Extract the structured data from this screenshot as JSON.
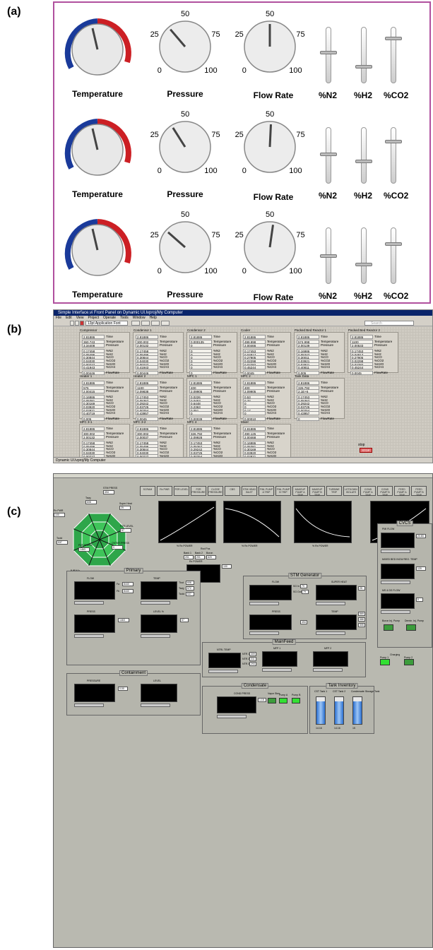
{
  "labels": {
    "a": "(a)",
    "b": "(b)",
    "c": "(c)"
  },
  "panel_a": {
    "rows": [
      {
        "temp_label": "Temperature",
        "pressure_label": "Pressure",
        "flow_label": "Flow Rate",
        "pressure_value": 35,
        "flow_value": 50,
        "n2": 0.58,
        "h2": 0.32,
        "co2": 0.82
      },
      {
        "temp_label": "Temperature",
        "pressure_label": "Pressure",
        "flow_label": "Flow Rate",
        "pressure_value": 38,
        "flow_value": 51,
        "n2": 0.55,
        "h2": 0.42,
        "co2": 0.78
      },
      {
        "temp_label": "Temperature",
        "pressure_label": "Pressure",
        "flow_label": "Flow Rate",
        "pressure_value": 32,
        "flow_value": 53,
        "n2": 0.52,
        "h2": 0.38,
        "co2": 0.74
      }
    ],
    "scale": {
      "s0": "0",
      "s25": "25",
      "s50": "50",
      "s75": "75",
      "s100": "100"
    },
    "slider_labels": {
      "n2": "%N2",
      "h2": "%H2",
      "co2": "%CO2"
    }
  },
  "panel_b": {
    "title": "Simple Interface.vi Front Panel on Dynamic UI.lvproj/My Computer",
    "menu": [
      "File",
      "Edit",
      "View",
      "Project",
      "Operate",
      "Tools",
      "Window",
      "Help"
    ],
    "font_select": "13pt Application Font",
    "search_placeholder": "Search",
    "row_names": {
      "time": "Time",
      "temp": "Temperature",
      "pres": "Pressure",
      "n2": "%N2",
      "h2": "%H2",
      "co": "%CO",
      "co2": "%CO2",
      "h2o": "%H2O",
      "ch4": "%CH4",
      "flow": "FlowRate"
    },
    "clusters": [
      {
        "name": "Compressor",
        "v": [
          "2.81886",
          "360.743",
          "3.34408",
          "0.17458",
          "0.05496",
          "0.30844",
          "0.04030",
          "0.00227",
          "0.41943",
          "0.00446"
        ]
      },
      {
        "name": "Condensor 1",
        "v": [
          "2.81886",
          "300.002",
          "2.00132",
          "0.17458",
          "0.05496",
          "0.30844",
          "0.04030",
          "0.00227",
          "0.41943",
          "0.00446"
        ]
      },
      {
        "name": "Condensor 2",
        "v": [
          "2.81886",
          "0.000135",
          "0",
          "0",
          "0",
          "0",
          "0",
          "0",
          "0",
          "0"
        ]
      },
      {
        "name": "Cooler",
        "v": [
          "2.81886",
          "499.998",
          "2.00466",
          "0.17453",
          "0.04817",
          "0.27905",
          "0.02298",
          "0.02282",
          "0.45244",
          "0.0045"
        ]
      },
      {
        "name": "Packed Bed Reactor 1",
        "v": [
          "2.81886",
          "574.998",
          "2.00139",
          "0.16986",
          "0.05347",
          "0.30011",
          "0.03921",
          "0.02921",
          "0.40811",
          "0.005"
        ]
      },
      {
        "name": "Packed Bed Reactor 2",
        "v": [
          "2.81886",
          "1100",
          "2.00533",
          "0.17453",
          "0.04817",
          "0.27905",
          "0.02298",
          "0.02282",
          "0.45244",
          "0.0045"
        ]
      },
      {
        "name": "Heater 1",
        "v": [
          "2.81886",
          "575",
          "2.00415",
          "0.16986",
          "0.05381",
          "0.30169",
          "0.03920",
          "0.02821",
          "0.40719",
          "0.005"
        ]
      },
      {
        "name": "Heater 2",
        "v": [
          "2.81886",
          "1100",
          "2.09838",
          "0.17453",
          "0.05367",
          "0.29242",
          "0.03725",
          "0.00254",
          "0.43957",
          "0.0045"
        ]
      },
      {
        "name": "MPC 1",
        "v": [
          "2.81886",
          "400",
          "2.09905",
          "0.0226",
          "0.0453",
          "0.6448",
          "0.2363",
          "0.051",
          "0",
          "0.00039"
        ]
      },
      {
        "name": "MPC 2",
        "v": [
          "2.81886",
          "400",
          "2.09905",
          "0.53",
          "0.32",
          "0",
          "0",
          "0.17",
          "0",
          "0.00010"
        ]
      },
      {
        "name": "Tank Data",
        "v": [
          "2.81886",
          "326.792",
          "2.1E+6",
          "0.17453",
          "0.05367",
          "0.29242",
          "0.03725",
          "0.00254",
          "0.43957",
          "0"
        ]
      },
      {
        "name": "MFC 3-1",
        "v": [
          "2.81886",
          "300.002",
          "2.00132",
          "0.17458",
          "0.05496",
          "0.30844",
          "0.04030",
          "0.00227",
          "0.41943",
          "0.00446"
        ]
      },
      {
        "name": "MFC 3-2",
        "v": [
          "2.81886",
          "300.002",
          "2.00037",
          "0.17458",
          "0.05496",
          "0.30844",
          "0.04030",
          "0.00227",
          "0.41943",
          "0.0004"
        ]
      },
      {
        "name": "MFC 4",
        "v": [
          "2.81886",
          "326.792",
          "2.09928",
          "0.17453",
          "0.05367",
          "0.29242",
          "0.03725",
          "0.00254",
          "0.43957",
          "0.0045"
        ]
      },
      {
        "name": "Mixer",
        "v": [
          "2.81886",
          "490.125",
          "2.00468",
          "0.16986",
          "0.05381",
          "0.30169",
          "0.03920",
          "0.02821",
          "0.40719",
          "0.005"
        ]
      }
    ],
    "stop_label": "stop",
    "stop_button": "STOP",
    "status": "Dynamic UI.lvproj/My Computer"
  },
  "panel_c": {
    "buttons": [
      "SCRAM",
      "Rx PWR",
      "PZR LEVEL",
      "PZR PRESSURE",
      "CLOSE PRESSURE",
      "CBS",
      "STM HEAD INLET",
      "FWL PUMP A TRIP",
      "FWL PUMP B TRIP",
      "MAKEUP PUMP A TRIP",
      "MAKEUP PUMP B TRIP",
      "TURBINE TRIP",
      "LETDOWN ISOLATE",
      "COND PUMP A TRIP",
      "COND PUMP B TRIP",
      "FEED PUMP A TRIP",
      "FEED PUMP B TRIP"
    ],
    "radar_labels": {
      "tavg": "Tavg",
      "stm_press": "STM PRESS",
      "super_heat": "Super Heat",
      "pzr_level": "PZR LEVEL",
      "cntmt_press": "CNTMT PRESS",
      "pzr_press": "PZR PRESS",
      "tcold": "Tcold",
      "rx_pwr": "Rx PWR"
    },
    "radar_values": {
      "tavg": "608",
      "stm_press": "494",
      "super_heat": "25",
      "pzr_level": "57",
      "cntmt_press": "0",
      "pzr_press": "1463",
      "tcold": "537",
      "rx_pwr": "100"
    },
    "mwe_label": "MWe",
    "mwe_value": "41.7",
    "chart_xlabel": "% Rx POWER",
    "rod_pos": "Rod Pos",
    "bank1": "Bank 1",
    "bank2": "Bank 2",
    "boron": "Boron",
    "bank1_v": "201",
    "bank2_v": "201",
    "boron_v": "620",
    "rx_power": "Rx POWER",
    "rx_power_v": "100",
    "groups": {
      "primary": "Primary",
      "containment": "Containment",
      "stm_gen": "STM Generator",
      "mainfeed": "MainFeed",
      "condensate": "Condensate",
      "tank_inventory": "Tank Inventory",
      "cvcs": "CVCS"
    },
    "primary": {
      "flow": "FLOW",
      "temp": "TEMP",
      "press": "PRESS",
      "level": "LEVEL %",
      "thot": "Thot",
      "tavg": "Tavg",
      "tcold": "Tcold",
      "thot_v": "606",
      "tavg_v": "572",
      "tcold_v": "537",
      "fa": "Fa",
      "fb": "Fb",
      "fa_v": "8440",
      "fb_v": "8440",
      "press_v": "1463",
      "level_v": "57"
    },
    "containment": {
      "pressure": "PRESSURE",
      "level": "LEVEL",
      "pressure_v": "0.00"
    },
    "stm": {
      "flow": "FLOW",
      "super_heat": "SUPER HEAT",
      "press": "PRESS",
      "temp": "TEMP",
      "sg_in": "SG In",
      "sg_out": "SG Out",
      "sg_in_v": "79",
      "sg_out_v": "79",
      "super_v": "25",
      "press_v": "494",
      "temp_v1": "569",
      "temp_v2": "466",
      "temp_v3": "305"
    },
    "mainfeed": {
      "ntrl_temp": "NTRL TEMP",
      "mfp1": "MFP 1",
      "mfp2": "MFP 2",
      "ntr1": "NTR 1",
      "ntr2": "NTR 2",
      "ntr3": "NTR 3",
      "ntr1_v": "309",
      "ntr2_v": "311",
      "ntr3_v": "293"
    },
    "condensate": {
      "cond_press": "COND PRESS",
      "cond_v": "1.15",
      "vacuum": "Vapor Stmr",
      "pump_a": "Pump A",
      "pump_b": "Pump B"
    },
    "tank": {
      "cst1": "CST Tank 1",
      "cst2": "CST Tank 2",
      "cond_tank": "Condensate Storage Tank",
      "v1": "14.16",
      "v2": "14.16",
      "v3": "15"
    },
    "cvcs": {
      "pmi_flow": "PMI FLOW",
      "pmi_v": "20.83",
      "mixed": "MIXED BED INCW REG. TEMP",
      "mixed_v": "120",
      "ms_flow": "MS & DS FLOW",
      "ms_v": "0",
      "boron_pump": "Boron Inj. Pump",
      "demin_pump": "Demin. Inj. Pump",
      "charging": "Charging",
      "pump1": "Pump 1",
      "pump2": "Pump 2"
    },
    "ctl": {
      "a": "TARG",
      "b": "FULL"
    }
  }
}
